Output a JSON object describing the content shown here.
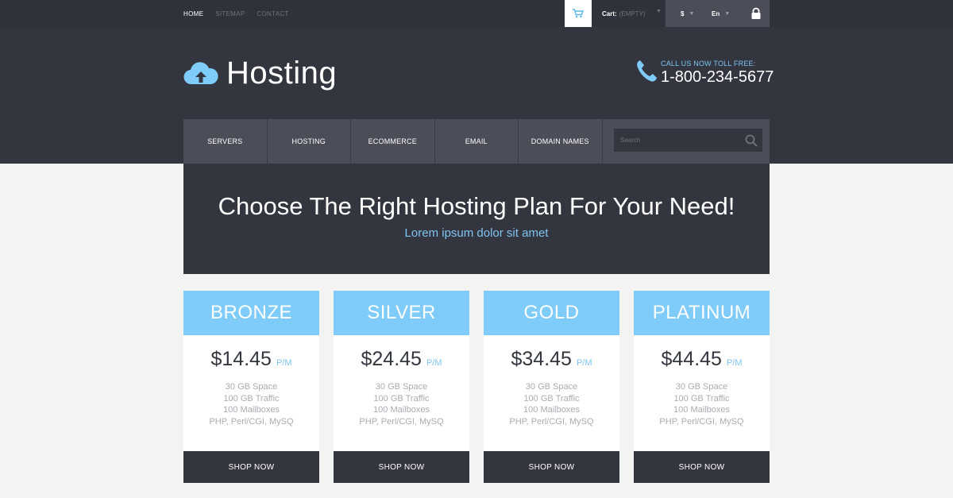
{
  "topnav": {
    "items": [
      {
        "label": "HOME",
        "active": true
      },
      {
        "label": "SITEMAP",
        "active": false
      },
      {
        "label": "CONTACT",
        "active": false
      }
    ]
  },
  "cart": {
    "label": "Cart:",
    "value": "(EMPTY)"
  },
  "currency": {
    "value": "$"
  },
  "language": {
    "value": "En"
  },
  "header": {
    "logo_text": "Hosting",
    "phone_call": "CALL US NOW TOLL FREE:",
    "phone_number": "1-800-234-5677"
  },
  "mainnav": {
    "items": [
      "SERVERS",
      "HOSTING",
      "ECOMMERCE",
      "EMAIL",
      "DOMAIN NAMES"
    ]
  },
  "search": {
    "placeholder": "Search"
  },
  "hero": {
    "title": "Choose The Right Hosting Plan For Your Need!",
    "subtitle": "Lorem ipsum dolor sit amet"
  },
  "plans": [
    {
      "name": "BRONZE",
      "price": "$14.45",
      "period": "P/M",
      "features": [
        "30 GB Space",
        "100 GB Traffic",
        "100 Mailboxes",
        "PHP, Perl/CGI, MySQ"
      ],
      "button": "SHOP NOW"
    },
    {
      "name": "SILVER",
      "price": "$24.45",
      "period": "P/M",
      "features": [
        "30 GB Space",
        "100 GB Traffic",
        "100 Mailboxes",
        "PHP, Perl/CGI, MySQ"
      ],
      "button": "SHOP NOW"
    },
    {
      "name": "GOLD",
      "price": "$34.45",
      "period": "P/M",
      "features": [
        "30 GB Space",
        "100 GB Traffic",
        "100 Mailboxes",
        "PHP, Perl/CGI, MySQ"
      ],
      "button": "SHOP NOW"
    },
    {
      "name": "PLATINUM",
      "price": "$44.45",
      "period": "P/M",
      "features": [
        "30 GB Space",
        "100 GB Traffic",
        "100 Mailboxes",
        "PHP, Perl/CGI, MySQ"
      ],
      "button": "SHOP NOW"
    }
  ],
  "icons": {
    "cart": "shopping-cart-icon",
    "lock": "lock-icon",
    "logo": "cloud-upload-icon",
    "phone": "phone-icon",
    "search": "search-icon"
  },
  "colors": {
    "accent": "#7fccfb",
    "dark": "#33363f",
    "topbar": "#2f323a",
    "nav": "#4b4e58",
    "background": "#f3f4f2"
  }
}
